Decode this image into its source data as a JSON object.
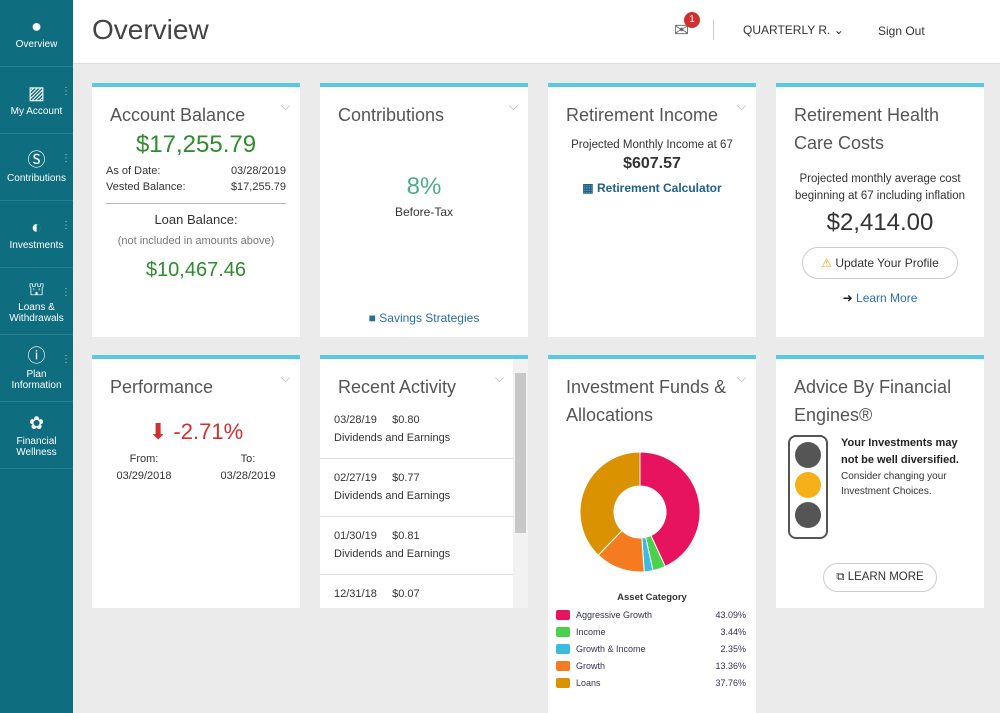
{
  "sidebar": {
    "items": [
      {
        "label": "Overview",
        "icon": "globe-icon"
      },
      {
        "label": "My Account",
        "icon": "chart-icon"
      },
      {
        "label": "Contributions",
        "icon": "dollar-icon"
      },
      {
        "label": "Investments",
        "icon": "refresh-icon"
      },
      {
        "label": "Loans & Withdrawals",
        "icon": "hands-icon"
      },
      {
        "label": "Plan Information",
        "icon": "info-icon"
      },
      {
        "label": "Financial Wellness",
        "icon": "plant-icon"
      }
    ]
  },
  "header": {
    "title": "Overview",
    "mail_count": "1",
    "plan_selector": "QUARTERLY R.",
    "sign_out": "Sign Out"
  },
  "account_balance": {
    "title": "Account Balance",
    "balance": "$17,255.79",
    "as_of_label": "As of Date:",
    "as_of": "03/28/2019",
    "vested_label": "Vested Balance:",
    "vested": "$17,255.79",
    "loan_label": "Loan Balance:",
    "loan_note": "(not included in amounts above)",
    "loan": "$10,467.46"
  },
  "contributions": {
    "title": "Contributions",
    "rate": "8%",
    "type": "Before-Tax",
    "link": "Savings Strategies"
  },
  "retirement_income": {
    "title": "Retirement Income",
    "label": "Projected Monthly Income at 67",
    "amount": "$607.57",
    "link": "Retirement Calculator"
  },
  "health_care": {
    "title": "Retirement Health Care Costs",
    "label": "Projected monthly average cost beginning at 67 including inflation",
    "amount": "$2,414.00",
    "button": "Update Your Profile",
    "link": "Learn More"
  },
  "performance": {
    "title": "Performance",
    "value": "-2.71%",
    "from_label": "From:",
    "to_label": "To:",
    "from": "03/29/2018",
    "to": "03/28/2019"
  },
  "recent_activity": {
    "title": "Recent Activity",
    "items": [
      {
        "date": "03/28/19",
        "amount": "$0.80",
        "desc": "Dividends and Earnings"
      },
      {
        "date": "02/27/19",
        "amount": "$0.77",
        "desc": "Dividends and Earnings"
      },
      {
        "date": "01/30/19",
        "amount": "$0.81",
        "desc": "Dividends and Earnings"
      },
      {
        "date": "12/31/18",
        "amount": "$0.07",
        "desc": ""
      }
    ]
  },
  "investments": {
    "title": "Investment Funds & Allocations",
    "legend_title": "Asset Category"
  },
  "chart_data": {
    "type": "pie",
    "categories": [
      "Aggressive Growth",
      "Income",
      "Growth & Income",
      "Growth",
      "Loans"
    ],
    "values": [
      43.09,
      3.44,
      2.35,
      13.36,
      37.76
    ],
    "labels": [
      "43.09%",
      "3.44%",
      "2.35%",
      "13.36%",
      "37.76%"
    ],
    "colors": [
      "#e8135f",
      "#4cd14c",
      "#3bbbe0",
      "#f47b20",
      "#db9200"
    ],
    "donut": true,
    "legend": "bottom"
  },
  "advice": {
    "title": "Advice By Financial Engines®",
    "bold": "Your Investments may not be well diversified.",
    "text": "Consider changing your Investment Choices.",
    "button": "LEARN MORE",
    "light": "yellow"
  }
}
